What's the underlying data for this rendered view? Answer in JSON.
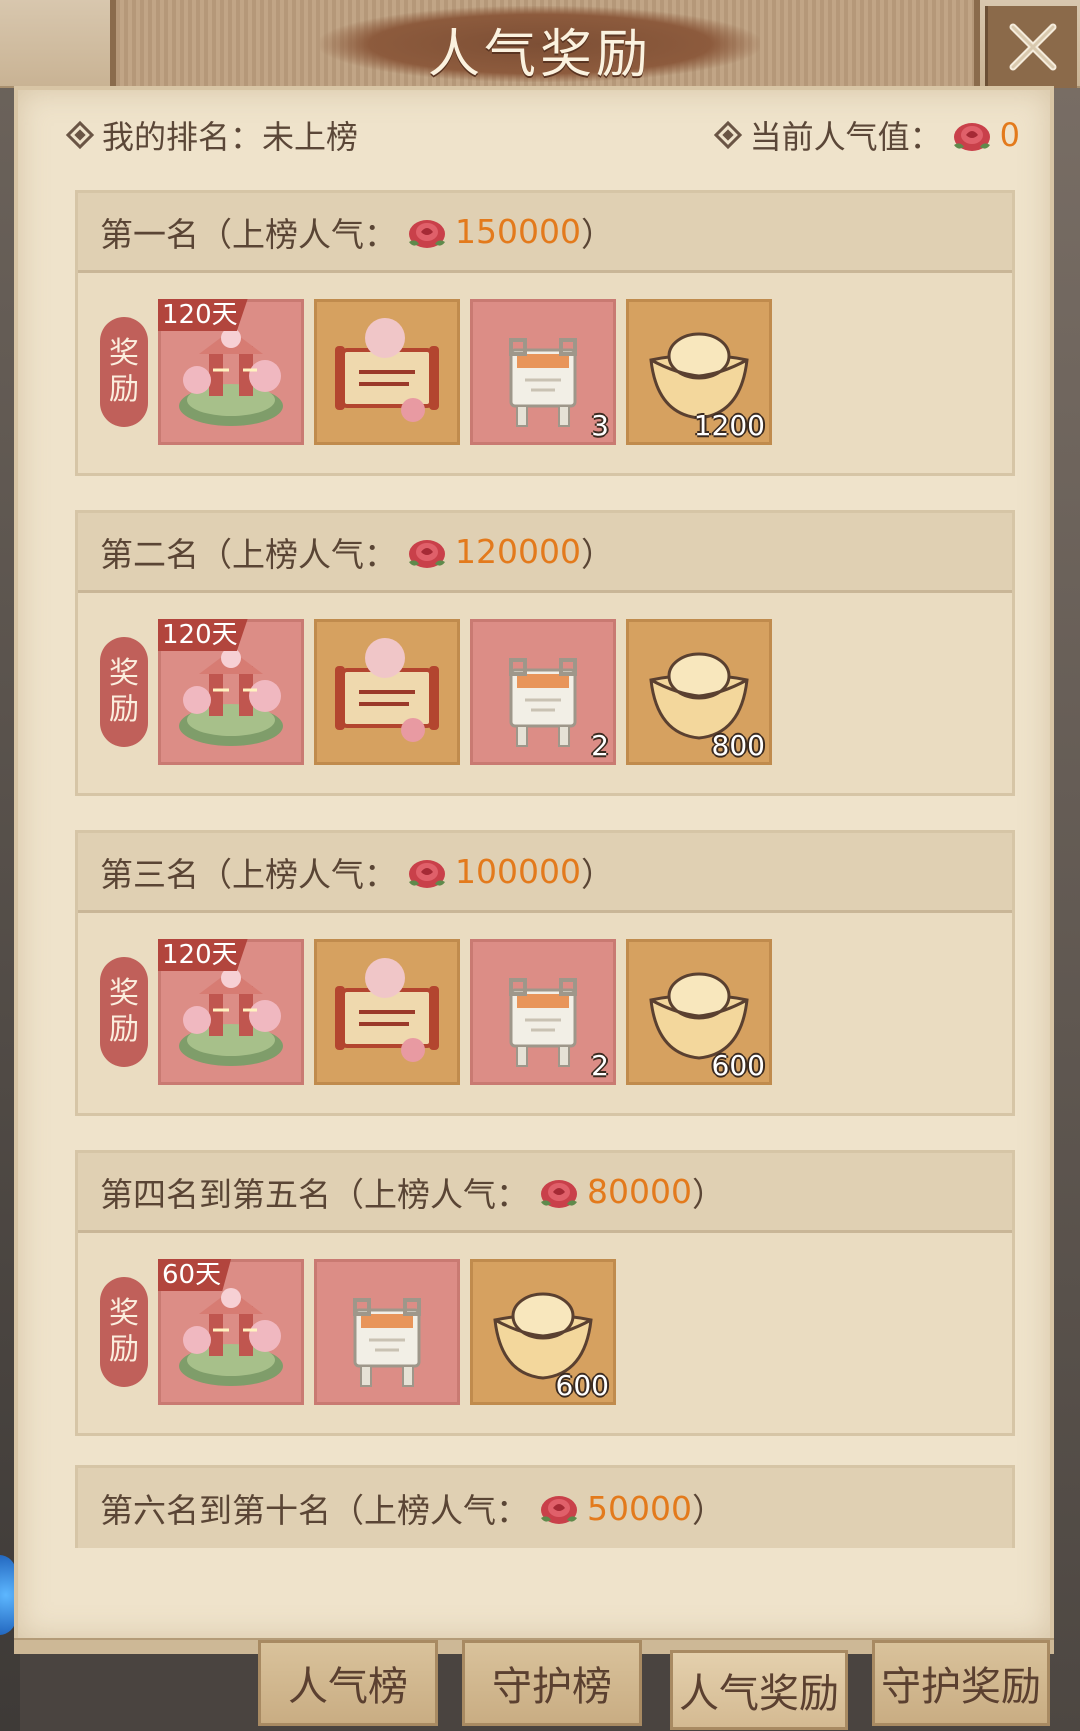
{
  "header": {
    "title": "人气奖励"
  },
  "my_rank": {
    "label": "我的排名：",
    "value": "未上榜"
  },
  "current_pop": {
    "label": "当前人气值：",
    "value": "0"
  },
  "sections": [
    {
      "title": "第一名（上榜人气：",
      "threshold": "150000",
      "close": "）",
      "reward_label": [
        "奖",
        "励"
      ],
      "items": [
        {
          "type": "garden",
          "badge": "120天",
          "qty": ""
        },
        {
          "type": "scroll",
          "badge": "",
          "qty": ""
        },
        {
          "type": "cauldron",
          "badge": "",
          "qty": "3"
        },
        {
          "type": "ingot",
          "badge": "",
          "qty": "1200"
        }
      ]
    },
    {
      "title": "第二名（上榜人气：",
      "threshold": "120000",
      "close": "）",
      "reward_label": [
        "奖",
        "励"
      ],
      "items": [
        {
          "type": "garden",
          "badge": "120天",
          "qty": ""
        },
        {
          "type": "scroll",
          "badge": "",
          "qty": ""
        },
        {
          "type": "cauldron",
          "badge": "",
          "qty": "2"
        },
        {
          "type": "ingot",
          "badge": "",
          "qty": "800"
        }
      ]
    },
    {
      "title": "第三名（上榜人气：",
      "threshold": "100000",
      "close": "）",
      "reward_label": [
        "奖",
        "励"
      ],
      "items": [
        {
          "type": "garden",
          "badge": "120天",
          "qty": ""
        },
        {
          "type": "scroll",
          "badge": "",
          "qty": ""
        },
        {
          "type": "cauldron",
          "badge": "",
          "qty": "2"
        },
        {
          "type": "ingot",
          "badge": "",
          "qty": "600"
        }
      ]
    },
    {
      "title": "第四名到第五名（上榜人气：",
      "threshold": "80000",
      "close": "）",
      "reward_label": [
        "奖",
        "励"
      ],
      "items": [
        {
          "type": "garden",
          "badge": "60天",
          "qty": ""
        },
        {
          "type": "cauldron",
          "badge": "",
          "qty": ""
        },
        {
          "type": "ingot",
          "badge": "",
          "qty": "600"
        }
      ]
    },
    {
      "title": "第六名到第十名（上榜人气：",
      "threshold": "50000",
      "close": "）"
    }
  ],
  "tabs": [
    {
      "label": "人气榜",
      "active": false
    },
    {
      "label": "守护榜",
      "active": false
    },
    {
      "label": "人气奖励",
      "active": true
    },
    {
      "label": "守护奖励",
      "active": false
    }
  ],
  "colors": {
    "accent": "#e37a1c",
    "tag": "#c0605a",
    "badge": "#b2453d"
  }
}
